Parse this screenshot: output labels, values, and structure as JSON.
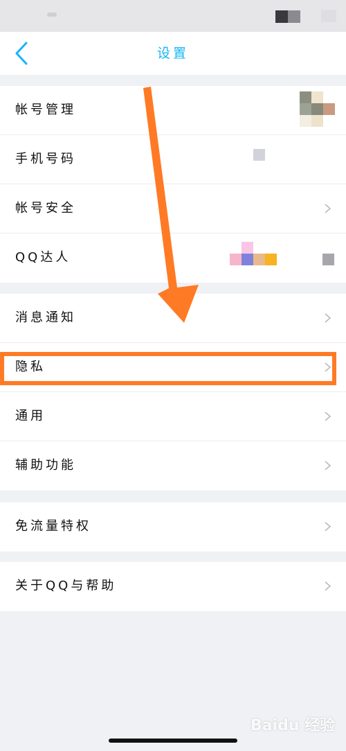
{
  "nav": {
    "title": "设置"
  },
  "groups": [
    {
      "items": [
        {
          "label": "帐号管理"
        },
        {
          "label": "手机号码"
        },
        {
          "label": "帐号安全"
        },
        {
          "label": "QQ达人"
        }
      ]
    },
    {
      "items": [
        {
          "label": "消息通知"
        },
        {
          "label": "隐私"
        },
        {
          "label": "通用"
        },
        {
          "label": "辅助功能"
        }
      ]
    },
    {
      "items": [
        {
          "label": "免流量特权"
        }
      ]
    },
    {
      "items": [
        {
          "label": "关于QQ与帮助"
        }
      ]
    }
  ],
  "colors": {
    "accent": "#12b7f5",
    "annotation": "#ff7a25",
    "background": "#eff1f5"
  },
  "watermark": "Baidu 经验",
  "icons": [
    "back-chevron-icon",
    "chevron-right-icon"
  ]
}
